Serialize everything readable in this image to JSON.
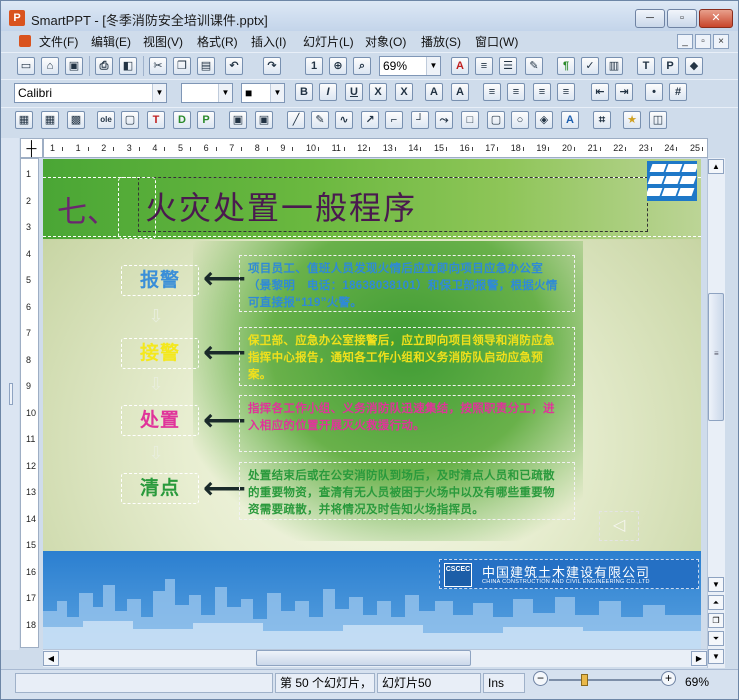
{
  "window": {
    "app_name": "SmartPPT",
    "title": "SmartPPT - [冬季消防安全培训课件.pptx]",
    "app_icon_letter": "P",
    "minimize": "─",
    "restore": "▫",
    "close": "✕"
  },
  "menu": [
    "文件(F)",
    "编辑(E)",
    "视图(V)",
    "格式(R)",
    "插入(I)",
    "幻灯片(L)",
    "对象(O)",
    "播放(S)",
    "窗口(W)"
  ],
  "mdi_buttons": [
    "_",
    "▫",
    "×"
  ],
  "toolbar": {
    "zoom": "69%",
    "font": "Calibri",
    "font_size": "",
    "color_label": "■"
  },
  "ruler": {
    "h": [
      "1",
      "1",
      "2",
      "3",
      "4",
      "5",
      "6",
      "7",
      "8",
      "9",
      "10",
      "11",
      "12",
      "13",
      "14",
      "15",
      "16",
      "17",
      "18",
      "19",
      "20",
      "21",
      "22",
      "23",
      "24",
      "25"
    ],
    "v": [
      "1",
      "2",
      "3",
      "4",
      "5",
      "6",
      "7",
      "8",
      "9",
      "10",
      "11",
      "12",
      "13",
      "14",
      "15",
      "16",
      "17",
      "18"
    ]
  },
  "slide": {
    "section_number": "七、",
    "section_title": "火灾处置一般程序",
    "steps": [
      {
        "label": "报警",
        "color": "#3a8fd8",
        "desc": "项目员工、值班人员发现火情后应立即向项目应急办公室（景黎明　电话：18638038101）和保卫部报警，根据火情可直接报“119”火警。",
        "desc_color": "#2f8ad6"
      },
      {
        "label": "接警",
        "color": "#f4e81c",
        "desc": "保卫部、应急办公室接警后，应立即向项目领导和消防应急指挥中心报告，通知各工作小组和义务消防队启动应急预案。",
        "desc_color": "#f0e01c"
      },
      {
        "label": "处置",
        "color": "#e0349a",
        "desc": "指挥各工作小组、义务消防队迅速集结，按照职责分工，进入相应的位置开展灭火救援行动。",
        "desc_color": "#e0349a"
      },
      {
        "label": "清点",
        "color": "#2a9a3c",
        "desc": "处置结束后或在公安消防队到场后，及时清点人员和已疏散的重要物资，查清有无人员被困于火场中以及有哪些重要物资需要疏散，并将情况及时告知火场指挥员。",
        "desc_color": "#2a9a3c"
      }
    ],
    "company_cn": "中国建筑土木建设有限公司",
    "company_en": "CHINA CONSTRUCTION AND CIVIL ENGINEERING CO.,LTD",
    "company_logo_text": "CSCEC"
  },
  "status": {
    "slide_position": "第 50 个幻灯片，",
    "slide_name": "幻灯片50",
    "ins": "Ins",
    "zoom": "69%"
  }
}
